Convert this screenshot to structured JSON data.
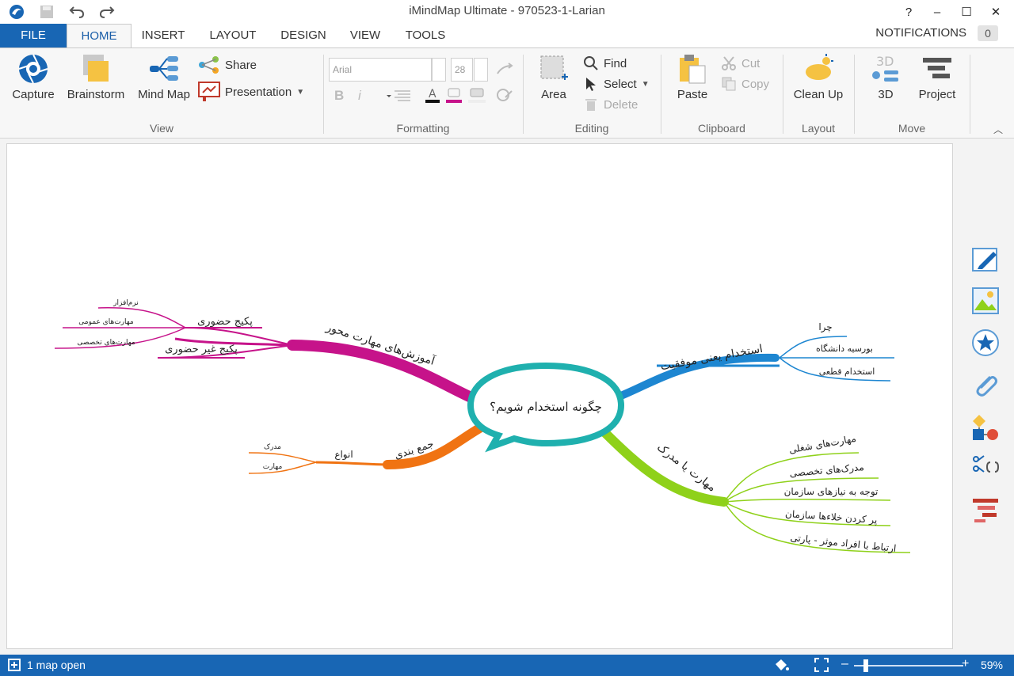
{
  "window": {
    "title": "iMindMap Ultimate - 970523-1-Larian",
    "help": "?",
    "minimize": "–",
    "maximize": "☐",
    "close": "✕"
  },
  "tabs": {
    "file": "FILE",
    "home": "HOME",
    "insert": "INSERT",
    "layout": "LAYOUT",
    "design": "DESIGN",
    "view": "VIEW",
    "tools": "TOOLS"
  },
  "notifications": {
    "label": "NOTIFICATIONS",
    "count": "0"
  },
  "ribbon": {
    "view": {
      "label": "View",
      "capture": "Capture",
      "brainstorm": "Brainstorm",
      "mindmap": "Mind Map",
      "share": "Share",
      "presentation": "Presentation"
    },
    "formatting": {
      "label": "Formatting",
      "font": "Arial",
      "size": "28",
      "bold": "B",
      "italic": "i"
    },
    "editing": {
      "label": "Editing",
      "area": "Area",
      "find": "Find",
      "select": "Select",
      "delete": "Delete"
    },
    "clipboard": {
      "label": "Clipboard",
      "paste": "Paste",
      "cut": "Cut",
      "copy": "Copy"
    },
    "layout": {
      "label": "Layout",
      "cleanup": "Clean Up"
    },
    "move": {
      "label": "Move",
      "threed": "3D",
      "project": "Project",
      "threed_icon_text": "3D"
    }
  },
  "mindmap": {
    "central": "چگونه استخدام شویم؟",
    "branches": {
      "training": {
        "label": "آموزش‌های مهارت محور",
        "color": "#c6138a",
        "sub": {
          "inperson": "پکیج حضوری",
          "online": "پکیج غیر حضوری",
          "leaves": [
            "نرم‌افزار",
            "مهارت‌های عمومی",
            "مهارت‌های تخصصی"
          ]
        }
      },
      "hiring": {
        "label": "استخدام یعنی موفقیت",
        "color": "#1d86d1",
        "leaves": [
          "چرا",
          "بورسیه دانشگاه",
          "استخدام قطعی"
        ]
      },
      "summary": {
        "label": "جمع بندی",
        "color": "#f07312",
        "sub": "انواع",
        "leaves": [
          "مدرک",
          "مهارت"
        ]
      },
      "skill": {
        "label": "مهارت یا مدرک",
        "color": "#8fd11a",
        "leaves": [
          "مهارت‌های شغلی",
          "مدرک‌های تخصصی",
          "توجه به نیازهای سازمان",
          "پر کردن خلاءها سازمان",
          "ارتباط با افراد موثر - پارتی"
        ]
      }
    },
    "central_color": "#1fb0ae"
  },
  "status": {
    "text": "1 map open",
    "zoom": "59%"
  },
  "icons": {
    "sidebar": [
      "pencil-icon",
      "image-icon",
      "star-icon",
      "attachment-icon",
      "shapes-icon",
      "code-icon",
      "gantt-icon"
    ]
  }
}
